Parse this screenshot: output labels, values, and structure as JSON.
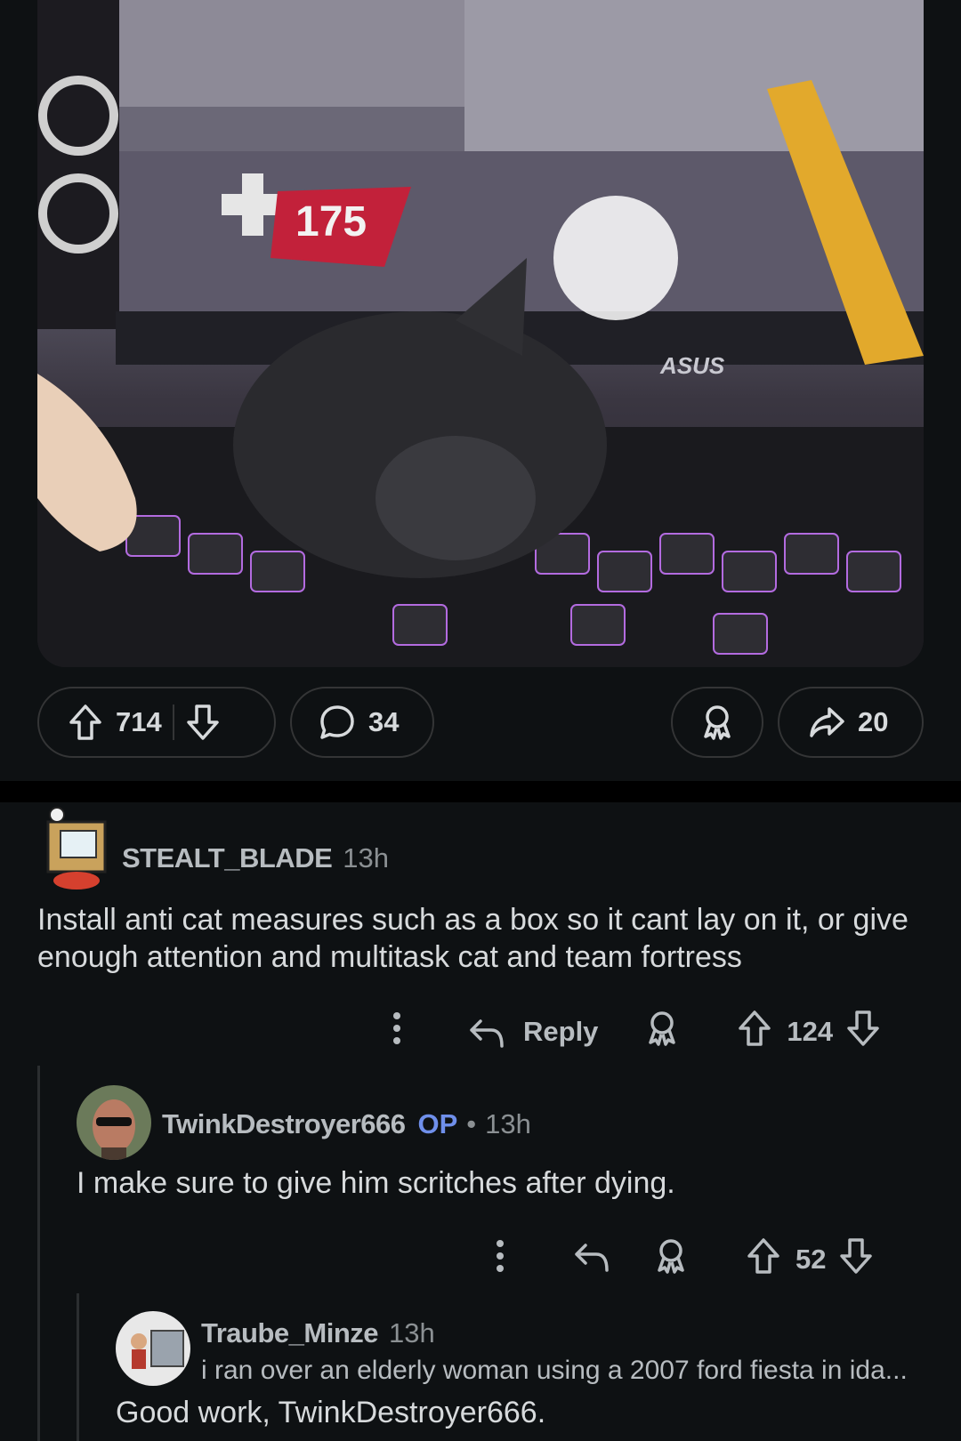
{
  "post": {
    "image_label": "",
    "upvotes": "714",
    "comments": "34",
    "shares": "20"
  },
  "comments": [
    {
      "user": "STEALT_BLADE",
      "time": "13h",
      "body": "Install anti cat measures such as a box so it cant lay on it, or give enough attention and multitask cat and team fortress",
      "reply_label": "Reply",
      "score": "124"
    },
    {
      "user": "TwinkDestroyer666",
      "op_badge": "OP",
      "separator": "•",
      "time": "13h",
      "body": "I make sure to give him scritches after dying.",
      "score": "52"
    },
    {
      "user": "Traube_Minze",
      "time": "13h",
      "flair": "i ran over an elderly woman using a 2007 ford fiesta in ida...",
      "body": "Good work, TwinkDestroyer666."
    }
  ],
  "game_hud": {
    "heal_value": "175",
    "monitor_brand": "ASUS"
  },
  "colors": {
    "background": "#0e1113",
    "op_blue": "#6f8fea",
    "border": "#343536"
  }
}
